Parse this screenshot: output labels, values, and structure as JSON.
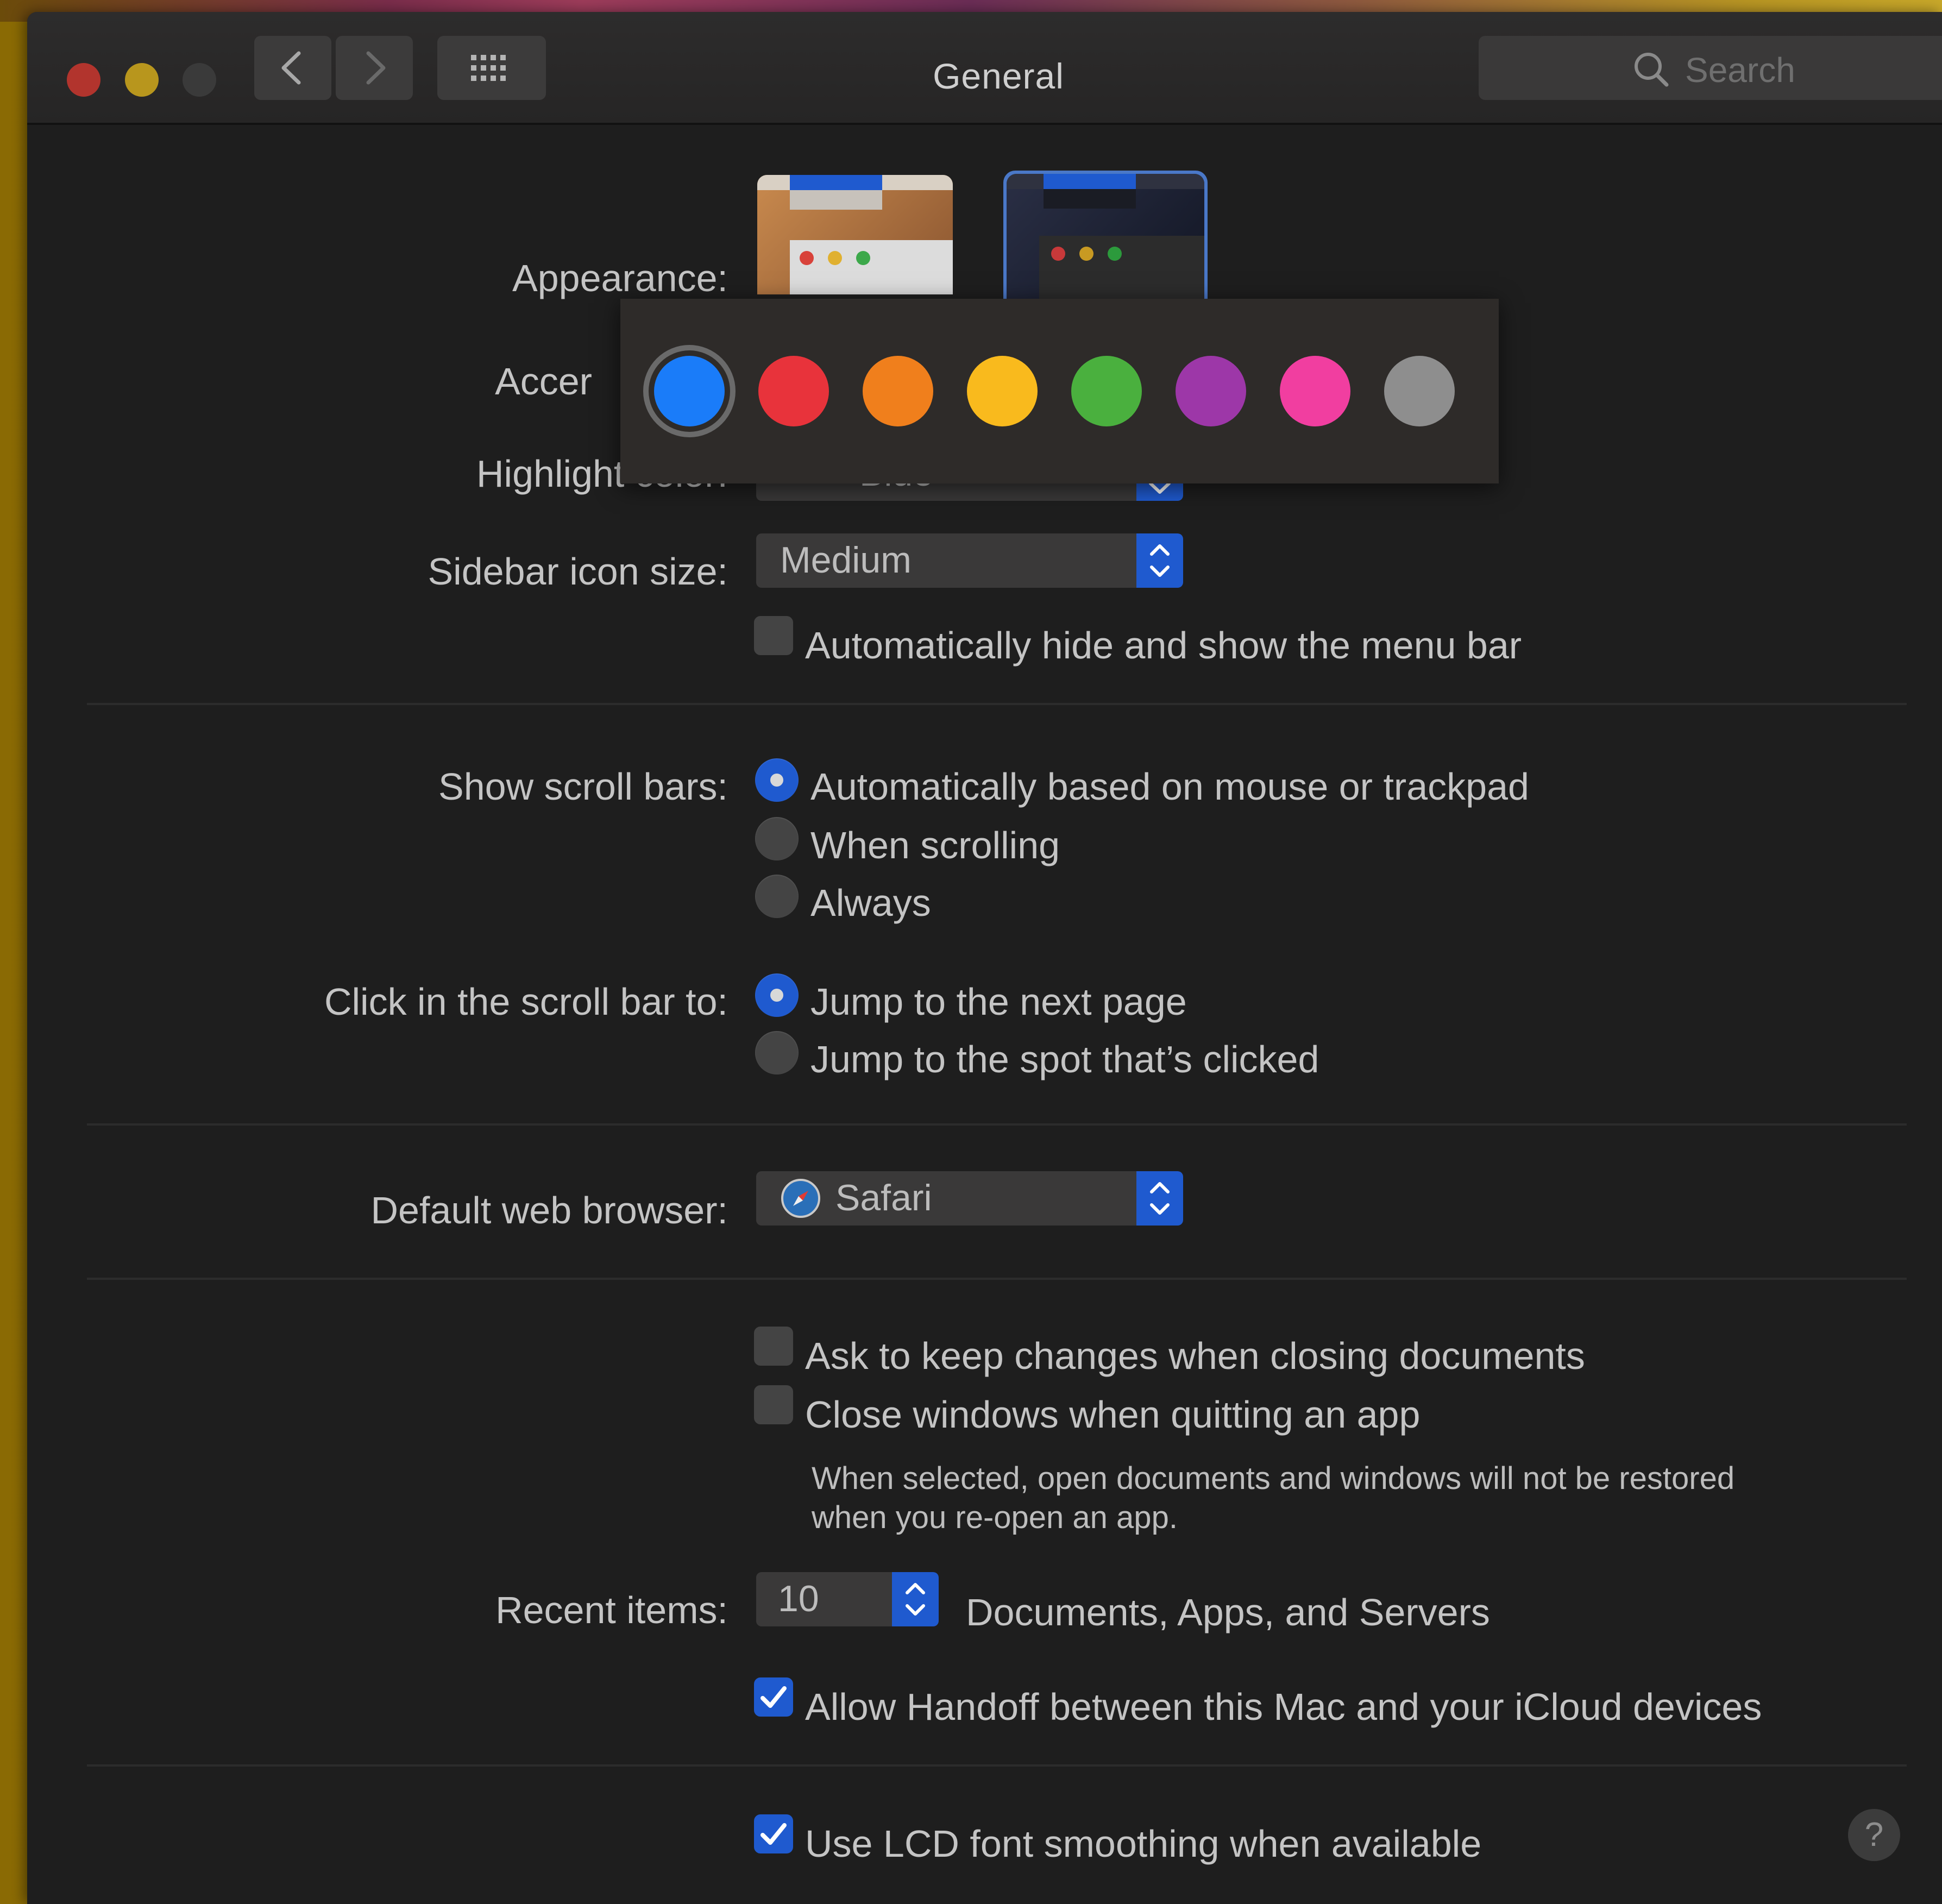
{
  "window": {
    "title": "General",
    "search_placeholder": "Search"
  },
  "toolbar": {
    "traffic_colors": {
      "close": "#b2342d",
      "minimize": "#b8961d",
      "zoom": "#3a3a3a"
    },
    "back_icon": "chevron-left-icon",
    "forward_icon": "chevron-right-icon",
    "grid_icon": "grid-icon"
  },
  "appearance": {
    "label": "Appearance:",
    "options": [
      "light-thumbnail",
      "dark-thumbnail"
    ],
    "selected": "dark-thumbnail"
  },
  "accent_color": {
    "label_partial": "Accer",
    "swatches": [
      {
        "name": "blue",
        "color": "#1a7cf9",
        "selected": true
      },
      {
        "name": "red",
        "color": "#e8333b",
        "selected": false
      },
      {
        "name": "orange",
        "color": "#f07f1c",
        "selected": false
      },
      {
        "name": "yellow",
        "color": "#f9ba1d",
        "selected": false
      },
      {
        "name": "green",
        "color": "#4ab03e",
        "selected": false
      },
      {
        "name": "purple",
        "color": "#9d37a8",
        "selected": false
      },
      {
        "name": "pink",
        "color": "#f13ea0",
        "selected": false
      },
      {
        "name": "graphite",
        "color": "#8e8e8e",
        "selected": false
      }
    ]
  },
  "highlight_color": {
    "label": "Highlight color:",
    "value": "Blue",
    "swatch_color": "#1f5acf"
  },
  "sidebar_icon_size": {
    "label": "Sidebar icon size:",
    "value": "Medium"
  },
  "menu_bar": {
    "label": "Automatically hide and show the menu bar",
    "checked": false
  },
  "scroll_bars": {
    "label": "Show scroll bars:",
    "options": [
      {
        "label": "Automatically based on mouse or trackpad",
        "selected": true
      },
      {
        "label": "When scrolling",
        "selected": false
      },
      {
        "label": "Always",
        "selected": false
      }
    ]
  },
  "click_scroll": {
    "label": "Click in the scroll bar to:",
    "options": [
      {
        "label": "Jump to the next page",
        "selected": true
      },
      {
        "label": "Jump to the spot that’s clicked",
        "selected": false
      }
    ]
  },
  "browser": {
    "label": "Default web browser:",
    "value": "Safari",
    "icon": "safari-icon"
  },
  "documents": {
    "ask_keep_changes": {
      "label": "Ask to keep changes when closing documents",
      "checked": false
    },
    "close_windows": {
      "label": "Close windows when quitting an app",
      "checked": false
    },
    "note_line1": "When selected, open documents and windows will not be restored",
    "note_line2": "when you re-open an app."
  },
  "recent_items": {
    "label": "Recent items:",
    "value": "10",
    "suffix": "Documents, Apps, and Servers"
  },
  "handoff": {
    "label": "Allow Handoff between this Mac and your iCloud devices",
    "checked": true
  },
  "lcd_smoothing": {
    "label": "Use LCD font smoothing when available",
    "checked": true
  },
  "help": {
    "label": "?"
  }
}
